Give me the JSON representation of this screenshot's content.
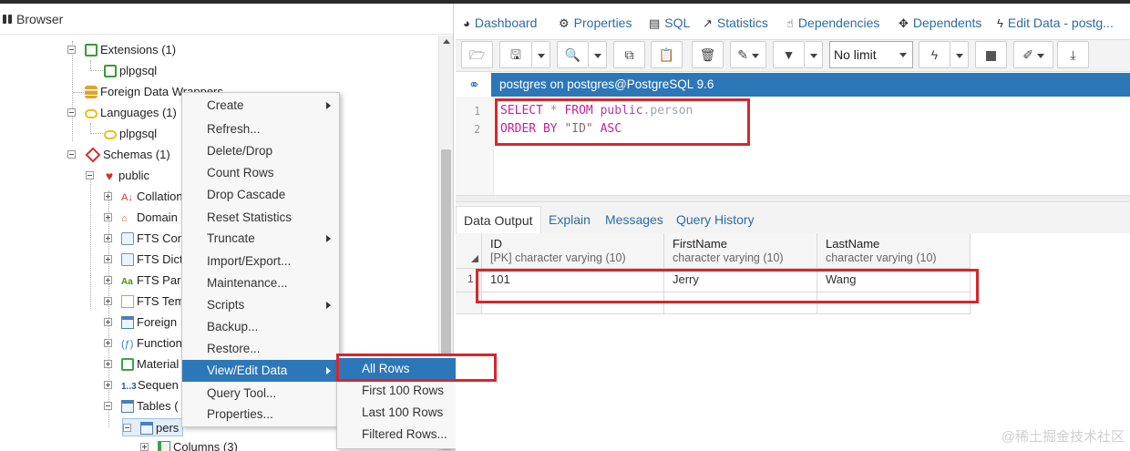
{
  "browser": {
    "title": "Browser",
    "tree": [
      {
        "label": "Extensions (1)"
      },
      {
        "label": "plpgsql"
      },
      {
        "label": "Foreign Data Wrappers"
      },
      {
        "label": "Languages (1)"
      },
      {
        "label": "plpgsql"
      },
      {
        "label": "Schemas (1)"
      },
      {
        "label": "public"
      },
      {
        "label": "Collation"
      },
      {
        "label": "Domain"
      },
      {
        "label": "FTS Con"
      },
      {
        "label": "FTS Dict"
      },
      {
        "label": "FTS Pars"
      },
      {
        "label": "FTS Tem"
      },
      {
        "label": "Foreign"
      },
      {
        "label": "Function"
      },
      {
        "label": "Material"
      },
      {
        "label": "Sequen"
      },
      {
        "label": "Tables ("
      },
      {
        "label": "pers"
      },
      {
        "label": "Columns (3)"
      }
    ]
  },
  "context_menu": {
    "items": [
      {
        "label": "Create"
      },
      {
        "label": "Refresh..."
      },
      {
        "label": "Delete/Drop"
      },
      {
        "label": "Count Rows"
      },
      {
        "label": "Drop Cascade"
      },
      {
        "label": "Reset Statistics"
      },
      {
        "label": "Truncate"
      },
      {
        "label": "Import/Export..."
      },
      {
        "label": "Maintenance..."
      },
      {
        "label": "Scripts"
      },
      {
        "label": "Backup..."
      },
      {
        "label": "Restore..."
      },
      {
        "label": "View/Edit Data"
      },
      {
        "label": "Query Tool..."
      },
      {
        "label": "Properties..."
      }
    ]
  },
  "submenu": {
    "items": [
      {
        "label": "All Rows"
      },
      {
        "label": "First 100 Rows"
      },
      {
        "label": "Last 100 Rows"
      },
      {
        "label": "Filtered Rows..."
      }
    ]
  },
  "tabs": [
    {
      "label": "Dashboard"
    },
    {
      "label": "Properties"
    },
    {
      "label": "SQL"
    },
    {
      "label": "Statistics"
    },
    {
      "label": "Dependencies"
    },
    {
      "label": "Dependents"
    },
    {
      "label": "Edit Data - postg..."
    }
  ],
  "toolbar": {
    "limit_value": "No limit"
  },
  "connection": {
    "label": "postgres on postgres@PostgreSQL 9.6"
  },
  "editor": {
    "line_numbers": [
      "1",
      "2"
    ],
    "line1": {
      "kw1": "SELECT",
      "star": "*",
      "kw2": "FROM",
      "schema": "public",
      "dot": ".",
      "table": "person"
    },
    "line2": {
      "kw1": "ORDER BY",
      "col": "\"ID\"",
      "kw2": "ASC"
    }
  },
  "output_tabs": [
    {
      "label": "Data Output"
    },
    {
      "label": "Explain"
    },
    {
      "label": "Messages"
    },
    {
      "label": "Query History"
    }
  ],
  "grid": {
    "columns": [
      {
        "name": "ID",
        "type": "[PK] character varying (10)"
      },
      {
        "name": "FirstName",
        "type": "character varying (10)"
      },
      {
        "name": "LastName",
        "type": "character varying (10)"
      }
    ],
    "rows": [
      {
        "num": "1",
        "cells": [
          "101",
          "Jerry",
          "Wang"
        ]
      }
    ]
  },
  "watermark": "@稀土掘金技术社区"
}
